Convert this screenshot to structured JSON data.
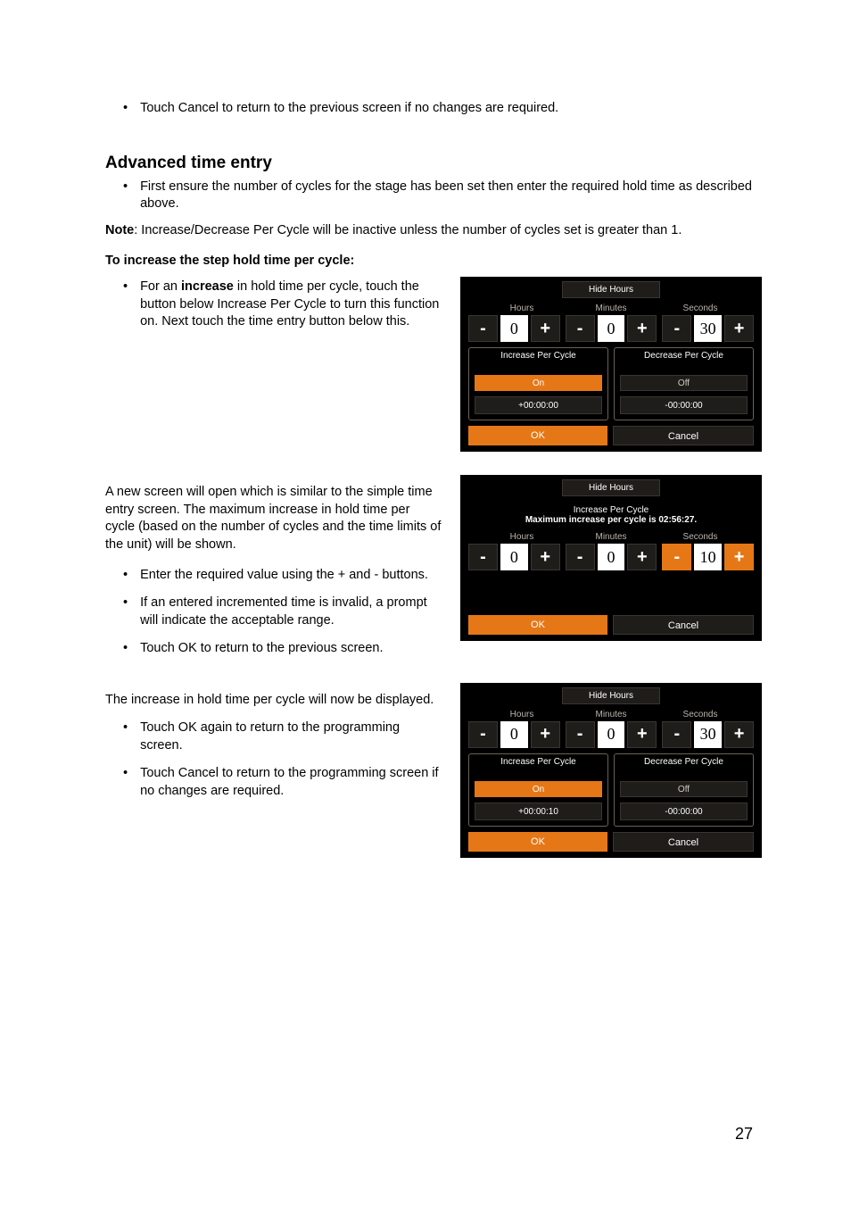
{
  "page_number": "27",
  "intro_bullet": "Touch Cancel to return to the previous screen if no changes are required.",
  "heading": "Advanced time entry",
  "heading_bullet": "First ensure the number of cycles for the stage has been set then enter the required hold time as described above.",
  "note_label": "Note",
  "note_text": ": Increase/Decrease Per Cycle will be inactive unless the number of cycles set is greater than 1.",
  "subheading": "To increase the step hold time per cycle:",
  "block1": {
    "bullet_pre": "For an ",
    "bullet_bold": "increase",
    "bullet_post": " in hold time per cycle, touch the button below Increase Per Cycle to turn this function on. Next touch the time entry button below this."
  },
  "block2": {
    "para": "A new screen will open which is similar to the simple time entry screen. The maximum increase in hold time per cycle (based on the number of cycles and the time limits of the unit) will be shown.",
    "bullets": [
      "Enter the required value using the + and - buttons.",
      "If an entered incremented time is invalid, a prompt will indicate the acceptable range.",
      "Touch OK to return to the previous screen."
    ]
  },
  "block3": {
    "para": "The increase in hold time per cycle will now be displayed.",
    "bullets": [
      "Touch OK again to return to the programming screen.",
      "Touch Cancel to return to the programming screen if no changes are required."
    ]
  },
  "ui": {
    "hide_hours": "Hide Hours",
    "hours": "Hours",
    "minutes": "Minutes",
    "seconds": "Seconds",
    "minus": "-",
    "plus": "+",
    "inc_title": "Increase Per Cycle",
    "dec_title": "Decrease Per Cycle",
    "on": "On",
    "off": "Off",
    "ok": "OK",
    "cancel": "Cancel"
  },
  "screen1": {
    "h": "0",
    "m": "0",
    "s": "30",
    "inc_time": "+00:00:00",
    "dec_time": "-00:00:00"
  },
  "screen2": {
    "sub1": "Increase Per Cycle",
    "sub2": "Maximum increase per cycle is 02:56:27.",
    "h": "0",
    "m": "0",
    "s": "10"
  },
  "screen3": {
    "h": "0",
    "m": "0",
    "s": "30",
    "inc_time": "+00:00:10",
    "dec_time": "-00:00:00"
  }
}
